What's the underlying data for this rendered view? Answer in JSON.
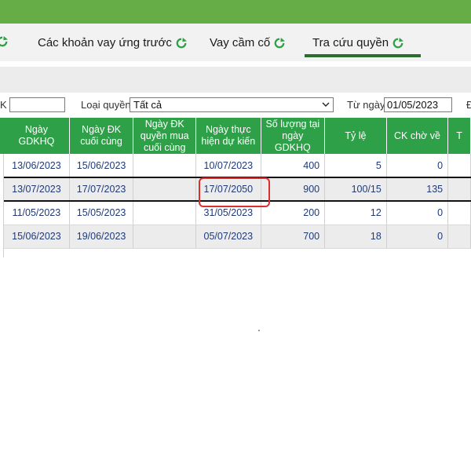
{
  "tabs": [
    {
      "label": "Các khoản vay ứng trước"
    },
    {
      "label": "Vay cầm cố"
    },
    {
      "label": "Tra cứu quyền",
      "active": true
    }
  ],
  "filters": {
    "ck_label": "K",
    "ck_value": "",
    "loai_quyen_label": "Loại quyền",
    "loai_quyen_value": "Tất cả",
    "tu_ngay_label": "Từ ngày",
    "tu_ngay_value": "01/05/2023",
    "next_label_fragment": "Đ"
  },
  "table": {
    "headers": [
      "Ngày GDKHQ",
      "Ngày ĐK cuối cùng",
      "Ngày ĐK quyền mua cuối cùng",
      "Ngày thực hiện dự kiến",
      "Số lượng tại ngày GDKHQ",
      "Tỷ lệ",
      "CK chờ về",
      "T"
    ],
    "rows": [
      {
        "gdkhq": "13/06/2023",
        "dk_cuoi": "15/06/2023",
        "dk_mua": "",
        "thuc_hien": "10/07/2023",
        "so_luong": "400",
        "ty_le": "5",
        "ck_cho_ve": "0",
        "t": ""
      },
      {
        "gdkhq": "13/07/2023",
        "dk_cuoi": "17/07/2023",
        "dk_mua": "",
        "thuc_hien": "17/07/2050",
        "so_luong": "900",
        "ty_le": "100/15",
        "ck_cho_ve": "135",
        "t": ""
      },
      {
        "gdkhq": "11/05/2023",
        "dk_cuoi": "15/05/2023",
        "dk_mua": "",
        "thuc_hien": "31/05/2023",
        "so_luong": "200",
        "ty_le": "12",
        "ck_cho_ve": "0",
        "t": ""
      },
      {
        "gdkhq": "15/06/2023",
        "dk_cuoi": "19/06/2023",
        "dk_mua": "",
        "thuc_hien": "05/07/2023",
        "so_luong": "700",
        "ty_le": "18",
        "ck_cho_ve": "0",
        "t": ""
      }
    ]
  },
  "colors": {
    "brand_green": "#2ea148",
    "top_bar": "#66ad47",
    "highlight": "#d9302f"
  },
  "icons": {
    "refresh": "refresh-icon",
    "dropdown": "chevron-down-icon"
  }
}
